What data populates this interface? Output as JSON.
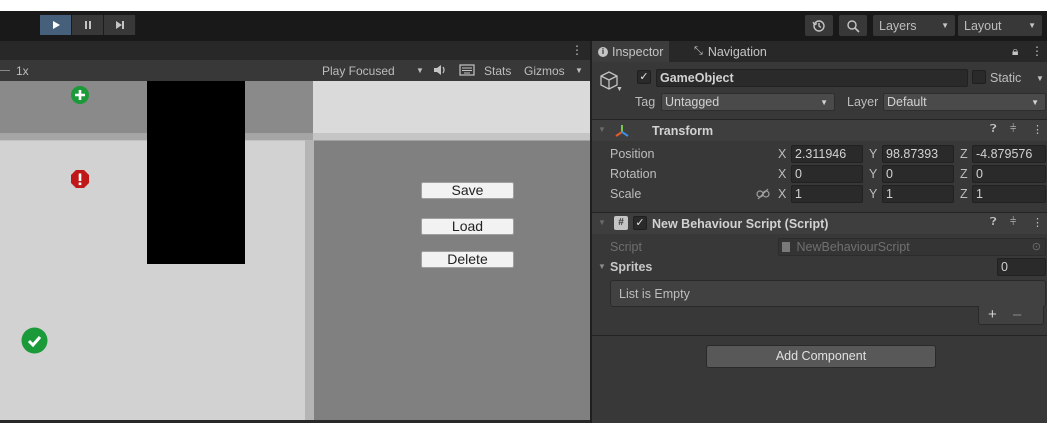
{
  "toolbar": {
    "play_icon": "play-icon",
    "pause_icon": "pause-icon",
    "step_icon": "step-icon",
    "history_icon": "history-icon",
    "search_icon": "search-icon",
    "layers_label": "Layers",
    "layout_label": "Layout"
  },
  "game": {
    "scale_label": "1x",
    "play_mode": "Play Focused",
    "stats_label": "Stats",
    "gizmos_label": "Gizmos",
    "buttons": {
      "save": "Save",
      "load": "Load",
      "delete": "Delete"
    }
  },
  "inspector": {
    "tabs": {
      "inspector": "Inspector",
      "navigation": "Navigation"
    },
    "object": {
      "name": "GameObject",
      "static_label": "Static",
      "tag_label": "Tag",
      "tag_value": "Untagged",
      "layer_label": "Layer",
      "layer_value": "Default"
    },
    "transform": {
      "title": "Transform",
      "position_label": "Position",
      "rotation_label": "Rotation",
      "scale_label": "Scale",
      "axis_x": "X",
      "axis_y": "Y",
      "axis_z": "Z",
      "position": {
        "x": "2.311946",
        "y": "98.87393",
        "z": "-4.879576"
      },
      "rotation": {
        "x": "0",
        "y": "0",
        "z": "0"
      },
      "scale": {
        "x": "1",
        "y": "1",
        "z": "1"
      }
    },
    "script_component": {
      "title": "New Behaviour Script (Script)",
      "script_label": "Script",
      "script_value": "NewBehaviourScript",
      "sprites_label": "Sprites",
      "sprites_count": "0",
      "empty_text": "List is Empty",
      "add_symbol": "+",
      "remove_symbol": "–"
    },
    "add_component": "Add Component"
  },
  "colors": {
    "accent": "#46607c",
    "panel": "#383838",
    "icon_green": "#1a9a38",
    "icon_red": "#c01818"
  }
}
